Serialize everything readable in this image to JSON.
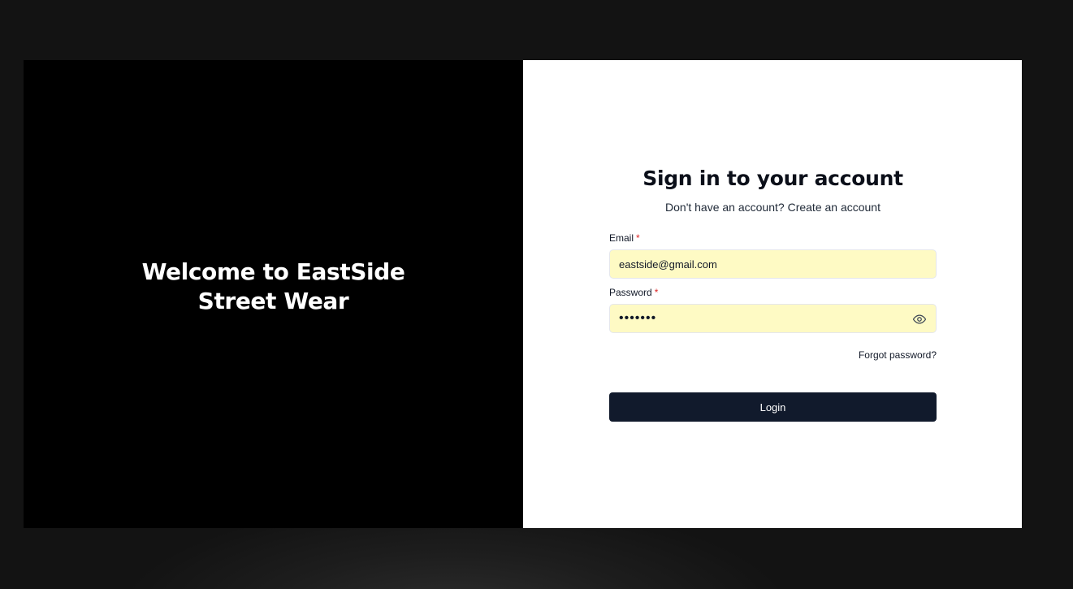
{
  "hero": {
    "title": "Welcome to EastSide Street Wear"
  },
  "signin": {
    "title": "Sign in to your account",
    "no_account_text": "Don't have an account?",
    "create_account_link": "Create an account",
    "email_label": "Email",
    "password_label": "Password",
    "required_marker": "*",
    "email_value": "eastside@gmail.com",
    "password_value": "1234567",
    "password_icon": "eye-icon",
    "forgot_password_link": "Forgot password?",
    "login_button": "Login"
  },
  "colors": {
    "page_background": "#131313",
    "hero_background": "#000000",
    "panel_background": "#ffffff",
    "input_fill": "#fefac4",
    "required": "#dc2626",
    "button": "#111a2c",
    "button_text": "#ffffff"
  }
}
